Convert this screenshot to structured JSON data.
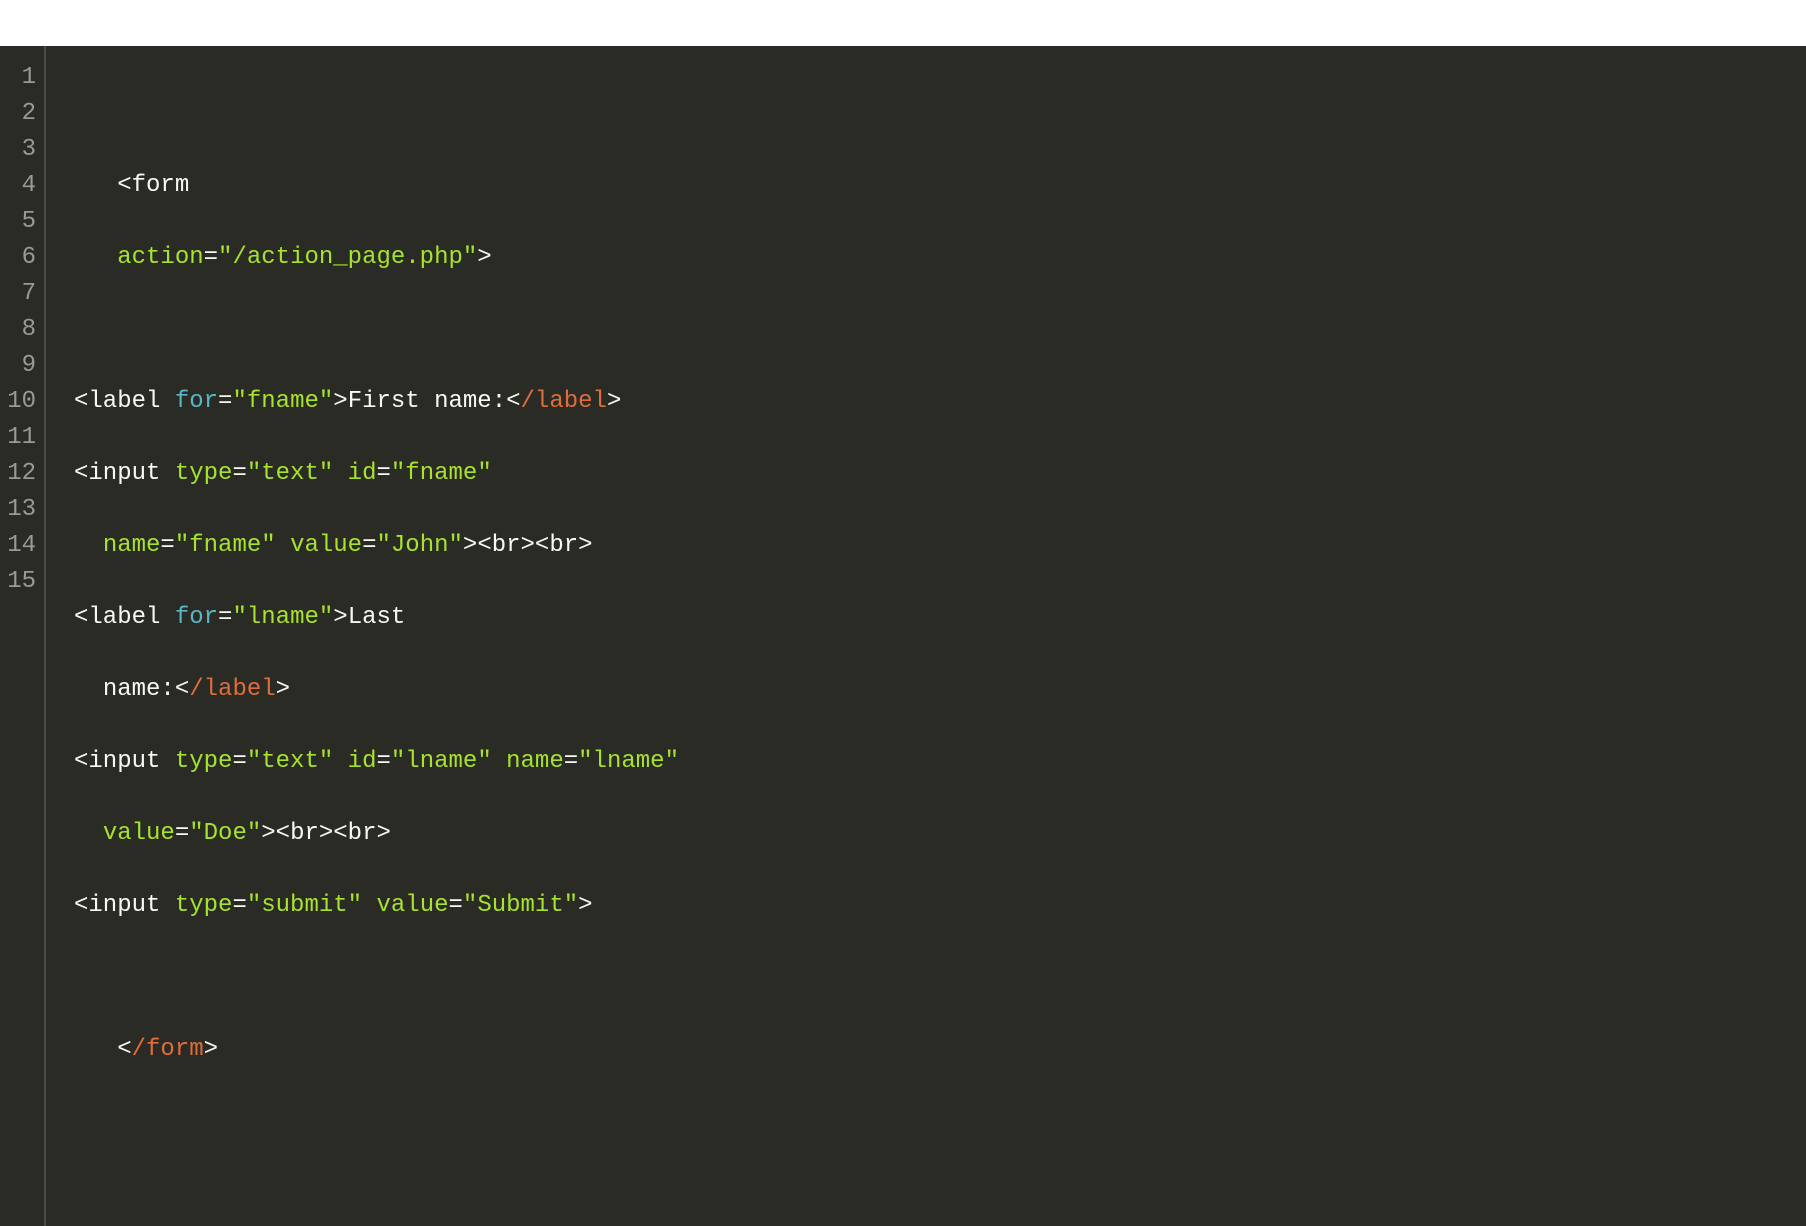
{
  "lineNumbers": [
    "1",
    "2",
    "3",
    "4",
    "5",
    "6",
    "7",
    "8",
    "9",
    "10",
    "11",
    "12",
    "13",
    "14",
    "15"
  ],
  "code": {
    "l1": "",
    "l2": {
      "indent": "   ",
      "open": "<",
      "tag": "form"
    },
    "l3": {
      "indent": "   ",
      "attr": "action",
      "eq": "=",
      "q1": "\"",
      "val": "/action_page.php",
      "q2": "\"",
      "close": ">"
    },
    "l4": "",
    "l5": {
      "open": "<",
      "tag": "label",
      "sp": " ",
      "for": "for",
      "eq": "=",
      "q1": "\"",
      "val": "fname",
      "q2": "\"",
      "gt": ">",
      "text": "First name:",
      "co": "<",
      "slash": "/label",
      "cgt": ">"
    },
    "l6": {
      "open": "<",
      "tag": "input",
      "sp": " ",
      "a1": "type",
      "eq1": "=",
      "q1": "\"",
      "v1": "text",
      "q2": "\"",
      "sp2": " ",
      "a2": "id",
      "eq2": "=",
      "q3": "\"",
      "v2": "fname",
      "q4": "\""
    },
    "l7": {
      "indent": "  ",
      "a1": "name",
      "eq1": "=",
      "q1": "\"",
      "v1": "fname",
      "q2": "\"",
      "sp": " ",
      "a2": "value",
      "eq2": "=",
      "q3": "\"",
      "v2": "John",
      "q4": "\"",
      "gt": ">",
      "br1": "<br>",
      "br2": "<br>"
    },
    "l8": {
      "open": "<",
      "tag": "label",
      "sp": " ",
      "for": "for",
      "eq": "=",
      "q1": "\"",
      "val": "lname",
      "q2": "\"",
      "gt": ">",
      "text": "Last"
    },
    "l9": {
      "indent": "  ",
      "text": "name:",
      "co": "<",
      "slash": "/label",
      "cgt": ">"
    },
    "l10": {
      "open": "<",
      "tag": "input",
      "sp": " ",
      "a1": "type",
      "eq1": "=",
      "q1": "\"",
      "v1": "text",
      "q2": "\"",
      "sp2": " ",
      "a2": "id",
      "eq2": "=",
      "q3": "\"",
      "v2": "lname",
      "q4": "\"",
      "sp3": " ",
      "a3": "name",
      "eq3": "=",
      "q5": "\"",
      "v3": "lname",
      "q6": "\""
    },
    "l11": {
      "indent": "  ",
      "a1": "value",
      "eq1": "=",
      "q1": "\"",
      "v1": "Doe",
      "q2": "\"",
      "gt": ">",
      "br1": "<br>",
      "br2": "<br>"
    },
    "l12": {
      "open": "<",
      "tag": "input",
      "sp": " ",
      "a1": "type",
      "eq1": "=",
      "q1": "\"",
      "v1": "submit",
      "q2": "\"",
      "sp2": " ",
      "a2": "value",
      "eq2": "=",
      "q3": "\"",
      "v2": "Submit",
      "q4": "\"",
      "gt": ">"
    },
    "l13": "",
    "l14": {
      "indent": "   ",
      "co": "<",
      "slash": "/form",
      "cgt": ">"
    },
    "l15": ""
  }
}
